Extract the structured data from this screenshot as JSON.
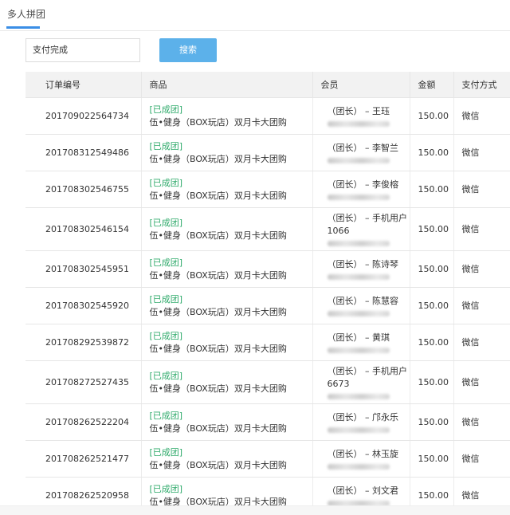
{
  "tab": {
    "label": "多人拼团"
  },
  "filter": {
    "status_value": "支付完成",
    "search_label": "搜索"
  },
  "table": {
    "headers": {
      "order": "订单编号",
      "product": "商品",
      "member": "会员",
      "amount": "金额",
      "pay": "支付方式"
    },
    "rows": [
      {
        "order": "201709022564734",
        "tag": "[已成团]",
        "product": "伍•健身（BOX玩店）双月卡大团购",
        "member": "（团长） – 王珏",
        "amount": "150.00",
        "pay": "微信"
      },
      {
        "order": "201708312549486",
        "tag": "[已成团]",
        "product": "伍•健身（BOX玩店）双月卡大团购",
        "member": "（团长） – 李智兰",
        "amount": "150.00",
        "pay": "微信"
      },
      {
        "order": "201708302546755",
        "tag": "[已成团]",
        "product": "伍•健身（BOX玩店）双月卡大团购",
        "member": "（团长） – 李俊榕",
        "amount": "150.00",
        "pay": "微信"
      },
      {
        "order": "201708302546154",
        "tag": "[已成团]",
        "product": "伍•健身（BOX玩店）双月卡大团购",
        "member": "（团长） – 手机用户1066",
        "amount": "150.00",
        "pay": "微信"
      },
      {
        "order": "201708302545951",
        "tag": "[已成团]",
        "product": "伍•健身（BOX玩店）双月卡大团购",
        "member": "（团长） – 陈诗琴",
        "amount": "150.00",
        "pay": "微信"
      },
      {
        "order": "201708302545920",
        "tag": "[已成团]",
        "product": "伍•健身（BOX玩店）双月卡大团购",
        "member": "（团长） – 陈慧容",
        "amount": "150.00",
        "pay": "微信"
      },
      {
        "order": "201708292539872",
        "tag": "[已成团]",
        "product": "伍•健身（BOX玩店）双月卡大团购",
        "member": "（团长） – 黄琪",
        "amount": "150.00",
        "pay": "微信"
      },
      {
        "order": "201708272527435",
        "tag": "[已成团]",
        "product": "伍•健身（BOX玩店）双月卡大团购",
        "member": "（团长） – 手机用户6673",
        "amount": "150.00",
        "pay": "微信"
      },
      {
        "order": "201708262522204",
        "tag": "[已成团]",
        "product": "伍•健身（BOX玩店）双月卡大团购",
        "member": "（团长） – 邝永乐",
        "amount": "150.00",
        "pay": "微信"
      },
      {
        "order": "201708262521477",
        "tag": "[已成团]",
        "product": "伍•健身（BOX玩店）双月卡大团购",
        "member": "（团长） – 林玉旋",
        "amount": "150.00",
        "pay": "微信"
      },
      {
        "order": "201708262520958",
        "tag": "[已成团]",
        "product": "伍•健身（BOX玩店）双月卡大团购",
        "member": "（团长） – 刘文君",
        "amount": "150.00",
        "pay": "微信"
      }
    ]
  },
  "colors": {
    "accent": "#3a8ee6",
    "button": "#5cb1ea",
    "tag": "#2eaa6a"
  }
}
